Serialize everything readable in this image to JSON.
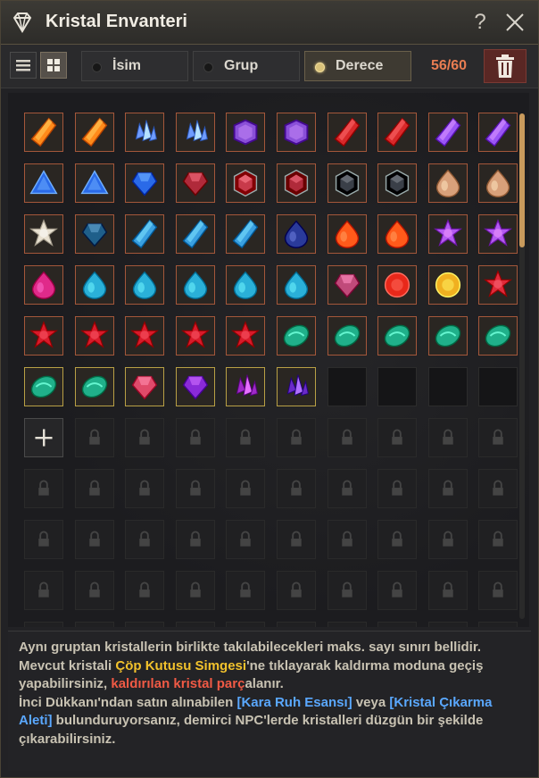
{
  "window": {
    "title": "Kristal Envanteri",
    "help_label": "?"
  },
  "toolbar": {
    "sort_buttons": [
      {
        "label": "İsim",
        "active": false
      },
      {
        "label": "Grup",
        "active": false
      },
      {
        "label": "Derece",
        "active": true
      }
    ],
    "count": "56/60"
  },
  "grid": {
    "columns": 10,
    "crystals": [
      {
        "color": "#ff8a1a",
        "shape": "shard"
      },
      {
        "color": "#ff8a1a",
        "shape": "shard"
      },
      {
        "color": "#6f9cff",
        "shape": "cluster"
      },
      {
        "color": "#6f9cff",
        "shape": "cluster"
      },
      {
        "color": "#8a4fd8",
        "shape": "hex"
      },
      {
        "color": "#8a4fd8",
        "shape": "hex"
      },
      {
        "color": "#d8282a",
        "shape": "shard"
      },
      {
        "color": "#d8282a",
        "shape": "shard"
      },
      {
        "color": "#9a55f5",
        "shape": "shard"
      },
      {
        "color": "#9a55f5",
        "shape": "shard"
      },
      {
        "color": "#2a6ae8",
        "shape": "tri"
      },
      {
        "color": "#2a6ae8",
        "shape": "tri"
      },
      {
        "color": "#2a6ae8",
        "shape": "gem"
      },
      {
        "color": "#b02a3a",
        "shape": "gem"
      },
      {
        "color": "#c83a4a",
        "shape": "hexring"
      },
      {
        "color": "#b02a3a",
        "shape": "hexring"
      },
      {
        "color": "#3a3f48",
        "shape": "hexring"
      },
      {
        "color": "#3a3f48",
        "shape": "hexring"
      },
      {
        "color": "#d8a07a",
        "shape": "drop"
      },
      {
        "color": "#d8a07a",
        "shape": "drop"
      },
      {
        "color": "#e8e0d0",
        "shape": "star"
      },
      {
        "color": "#1f5f8a",
        "shape": "gem"
      },
      {
        "color": "#3aa0e0",
        "shape": "shard"
      },
      {
        "color": "#3aa0e0",
        "shape": "shard"
      },
      {
        "color": "#3aa0e0",
        "shape": "shard"
      },
      {
        "color": "#2a3a9a",
        "shape": "drop"
      },
      {
        "color": "#ff5a1a",
        "shape": "drop"
      },
      {
        "color": "#ff5a1a",
        "shape": "drop"
      },
      {
        "color": "#b45af0",
        "shape": "star"
      },
      {
        "color": "#b45af0",
        "shape": "star"
      },
      {
        "color": "#e02a8a",
        "shape": "drop"
      },
      {
        "color": "#2ab0d8",
        "shape": "drop"
      },
      {
        "color": "#2ab0d8",
        "shape": "drop"
      },
      {
        "color": "#2ab0d8",
        "shape": "drop"
      },
      {
        "color": "#2ab0d8",
        "shape": "drop"
      },
      {
        "color": "#2ab0d8",
        "shape": "drop"
      },
      {
        "color": "#c04a7a",
        "shape": "gem"
      },
      {
        "color": "#e8281a",
        "shape": "round"
      },
      {
        "color": "#f0b020",
        "shape": "round"
      },
      {
        "color": "#e02a3a",
        "shape": "star"
      },
      {
        "color": "#d81a2a",
        "shape": "star"
      },
      {
        "color": "#d81a2a",
        "shape": "star"
      },
      {
        "color": "#d81a2a",
        "shape": "star"
      },
      {
        "color": "#d81a2a",
        "shape": "star"
      },
      {
        "color": "#d81a2a",
        "shape": "star"
      },
      {
        "color": "#20b08a",
        "shape": "oval"
      },
      {
        "color": "#20b08a",
        "shape": "oval"
      },
      {
        "color": "#20b08a",
        "shape": "oval"
      },
      {
        "color": "#20b08a",
        "shape": "oval"
      },
      {
        "color": "#20b08a",
        "shape": "oval"
      },
      {
        "color": "#20b08a",
        "shape": "oval"
      },
      {
        "color": "#20b08a",
        "shape": "oval"
      },
      {
        "color": "#e04a6a",
        "shape": "gem"
      },
      {
        "color": "#8a2ad8",
        "shape": "gem"
      },
      {
        "color": "#a02ac8",
        "shape": "cluster"
      },
      {
        "color": "#6a2ac8",
        "shape": "cluster"
      }
    ],
    "empty_slots": 4,
    "add_label": "+"
  },
  "description": {
    "p1": "Aynı gruptan kristallerin birlikte takılabilecekleri maks. sayı sınırı bellidir.",
    "p2a": "Mevcut kristali ",
    "p2b": "Çöp Kutusu Simgesi",
    "p2c": "'ne tıklayarak kaldırma moduna geçiş yapabilirsiniz, ",
    "p2d": "kaldırılan kristal parç",
    "p2e": "alanır.",
    "p3a": "İnci Dükkanı'ndan satın alınabilen ",
    "p3b": "[Kara Ruh Esansı]",
    "p3c": " veya ",
    "p3d": "[Kristal Çıkarma Aleti]",
    "p3e": " bulunduruyorsanız, demirci NPC'lerde kristalleri düzgün bir şekilde çıkarabilirsiniz."
  }
}
